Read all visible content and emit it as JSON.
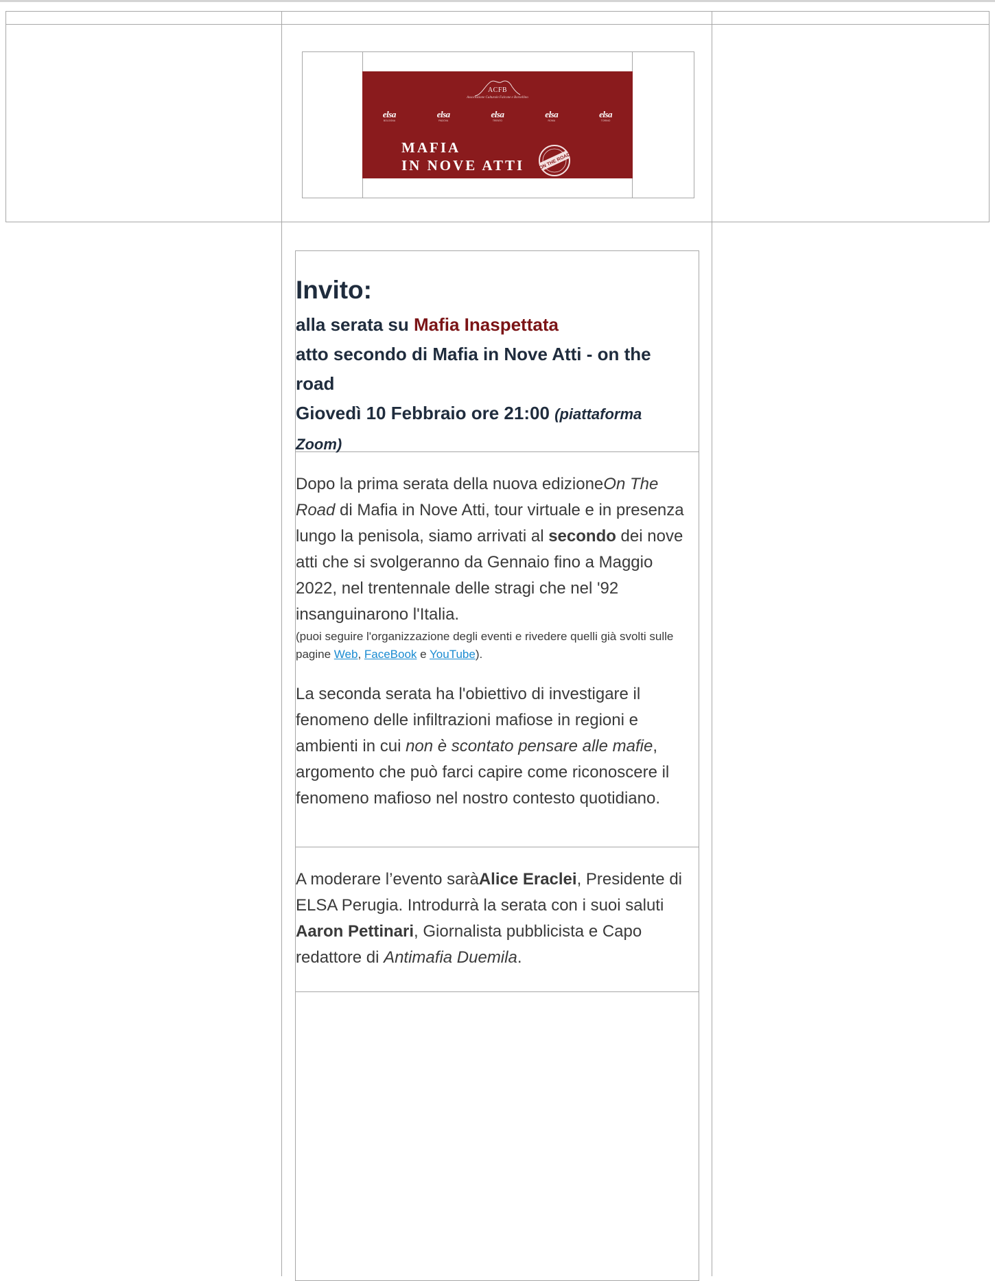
{
  "banner": {
    "acfb": "ACFB",
    "acfb_sub": "Associazione Culturale Falcone e Borsellino",
    "elsa_logos": [
      {
        "name": "elsa",
        "tag": "BOLOGNA"
      },
      {
        "name": "elsa",
        "tag": "PADOVA"
      },
      {
        "name": "elsa",
        "tag": "TRENTO"
      },
      {
        "name": "elsa",
        "tag": "ROMA"
      },
      {
        "name": "elsa",
        "tag": "TORINO"
      }
    ],
    "title_line1": "MAFIA",
    "title_line2": "IN NOVE ATTI",
    "stamp": "ON THE ROAD"
  },
  "invite": {
    "heading": "Invito:",
    "line1_prefix": "alla serata su ",
    "line1_highlight": "Mafia Inaspettata",
    "line2": "atto secondo di Mafia in Nove Atti - on the road",
    "date": "Giovedì 10 Febbraio ore 21:00",
    "platform": "(piattaforma Zoom)"
  },
  "para1": {
    "t1": "Dopo la prima serata della nuova edizione",
    "t1_ital": "On The Road",
    "t2": " di Mafia in Nove Atti, tour virtuale e in presenza lungo la penisola, siamo arrivati al ",
    "t2_bold": "secondo",
    "t3": " dei nove atti che si svolgeranno da Gennaio fino a Maggio 2022, nel trentennale delle stragi che nel '92 insanguinarono l'Italia.",
    "small1": "(puoi seguire l'organizzazione degli eventi e rivedere quelli già svolti sulle pagine ",
    "link_web": "Web",
    "sep": ", ",
    "link_fb": "FaceBook",
    "and": " e ",
    "link_yt": "YouTube",
    "small_end": ").",
    "p2a": "La seconda serata ha l'obiettivo di investigare il fenomeno delle infiltrazioni mafiose in regioni e ambienti in cui ",
    "p2_ital": "non è scontato pensare alle mafie",
    "p2b": ", argomento che può farci capire come riconoscere il fenomeno mafioso nel nostro contesto quotidiano."
  },
  "para2": {
    "a": "A moderare l’evento sarà",
    "b_bold": "Alice Eraclei",
    "c": ", Presidente di ELSA Perugia. Introdurrà la serata con i suoi saluti ",
    "d_bold": "Aaron Pettinari",
    "e": ", Giornalista pubblicista e Capo redattore di ",
    "f_ital": "Antimafia Duemila",
    "g": "."
  }
}
